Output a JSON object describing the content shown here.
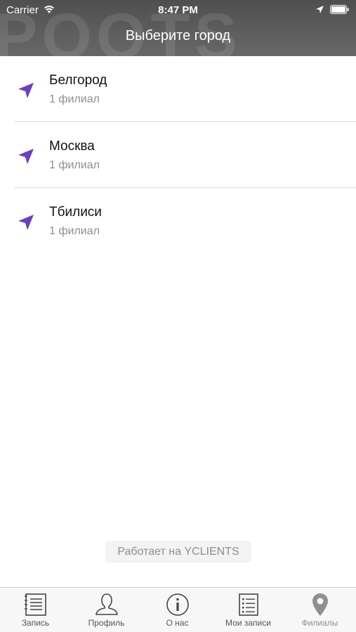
{
  "status_bar": {
    "carrier": "Carrier",
    "time": "8:47 PM"
  },
  "header": {
    "title": "Выберите город",
    "background_letters": "POOTS"
  },
  "cities": [
    {
      "name": "Белгород",
      "branches": "1 филиал"
    },
    {
      "name": "Москва",
      "branches": "1 филиал"
    },
    {
      "name": "Тбилиси",
      "branches": "1 филиал"
    }
  ],
  "footer": {
    "powered_by": "Работает на YCLIENTS"
  },
  "tabs": [
    {
      "label": "Запись",
      "icon": "notepad-icon"
    },
    {
      "label": "Профиль",
      "icon": "person-icon"
    },
    {
      "label": "О нас",
      "icon": "info-icon"
    },
    {
      "label": "Мои записи",
      "icon": "list-icon"
    },
    {
      "label": "Филиалы",
      "icon": "map-pin-icon",
      "active": true
    }
  ],
  "colors": {
    "accent": "#6a3fc8",
    "header_bg": "#5a5a5a",
    "tab_icon": "#444444",
    "tab_active": "#8e8e93"
  }
}
